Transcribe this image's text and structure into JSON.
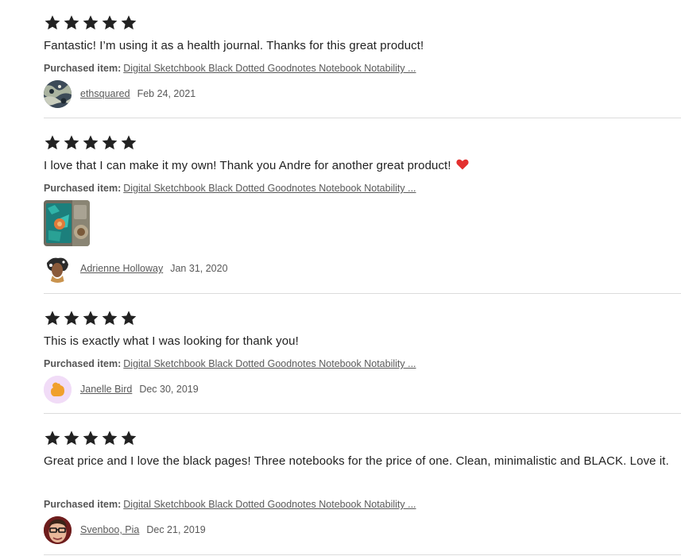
{
  "colors": {
    "star": "#222222",
    "heart": "#e3302f",
    "divider": "#dcdcdc",
    "muted_text": "#595959"
  },
  "reviews": [
    {
      "rating": 5,
      "text": "Fantastic! I’m using it as a health journal. Thanks for this great product!",
      "purchased_label": "Purchased item:",
      "purchased_item": "Digital Sketchbook Black Dotted Goodnotes Notebook Notability ...",
      "reviewer": "ethsquared",
      "date": "Feb 24, 2021"
    },
    {
      "rating": 5,
      "text": "I love that I can make it my own! Thank you Andre for another great product!",
      "has_heart_icon": true,
      "purchased_label": "Purchased item:",
      "purchased_item": "Digital Sketchbook Black Dotted Goodnotes Notebook Notability ...",
      "has_photo": true,
      "reviewer": "Adrienne Holloway",
      "date": "Jan 31, 2020"
    },
    {
      "rating": 5,
      "text": "This is exactly what I was looking for thank you!",
      "purchased_label": "Purchased item:",
      "purchased_item": "Digital Sketchbook Black Dotted Goodnotes Notebook Notability ...",
      "reviewer": "Janelle Bird",
      "date": "Dec 30, 2019"
    },
    {
      "rating": 5,
      "text": "Great price and I love the black pages! Three notebooks for the price of one. Clean, minimalistic and BLACK. Love it.",
      "purchased_label": "Purchased item:",
      "purchased_item": "Digital Sketchbook Black Dotted Goodnotes Notebook Notability ...",
      "reviewer": "Svenboo, Pia",
      "date": "Dec 21, 2019"
    }
  ]
}
